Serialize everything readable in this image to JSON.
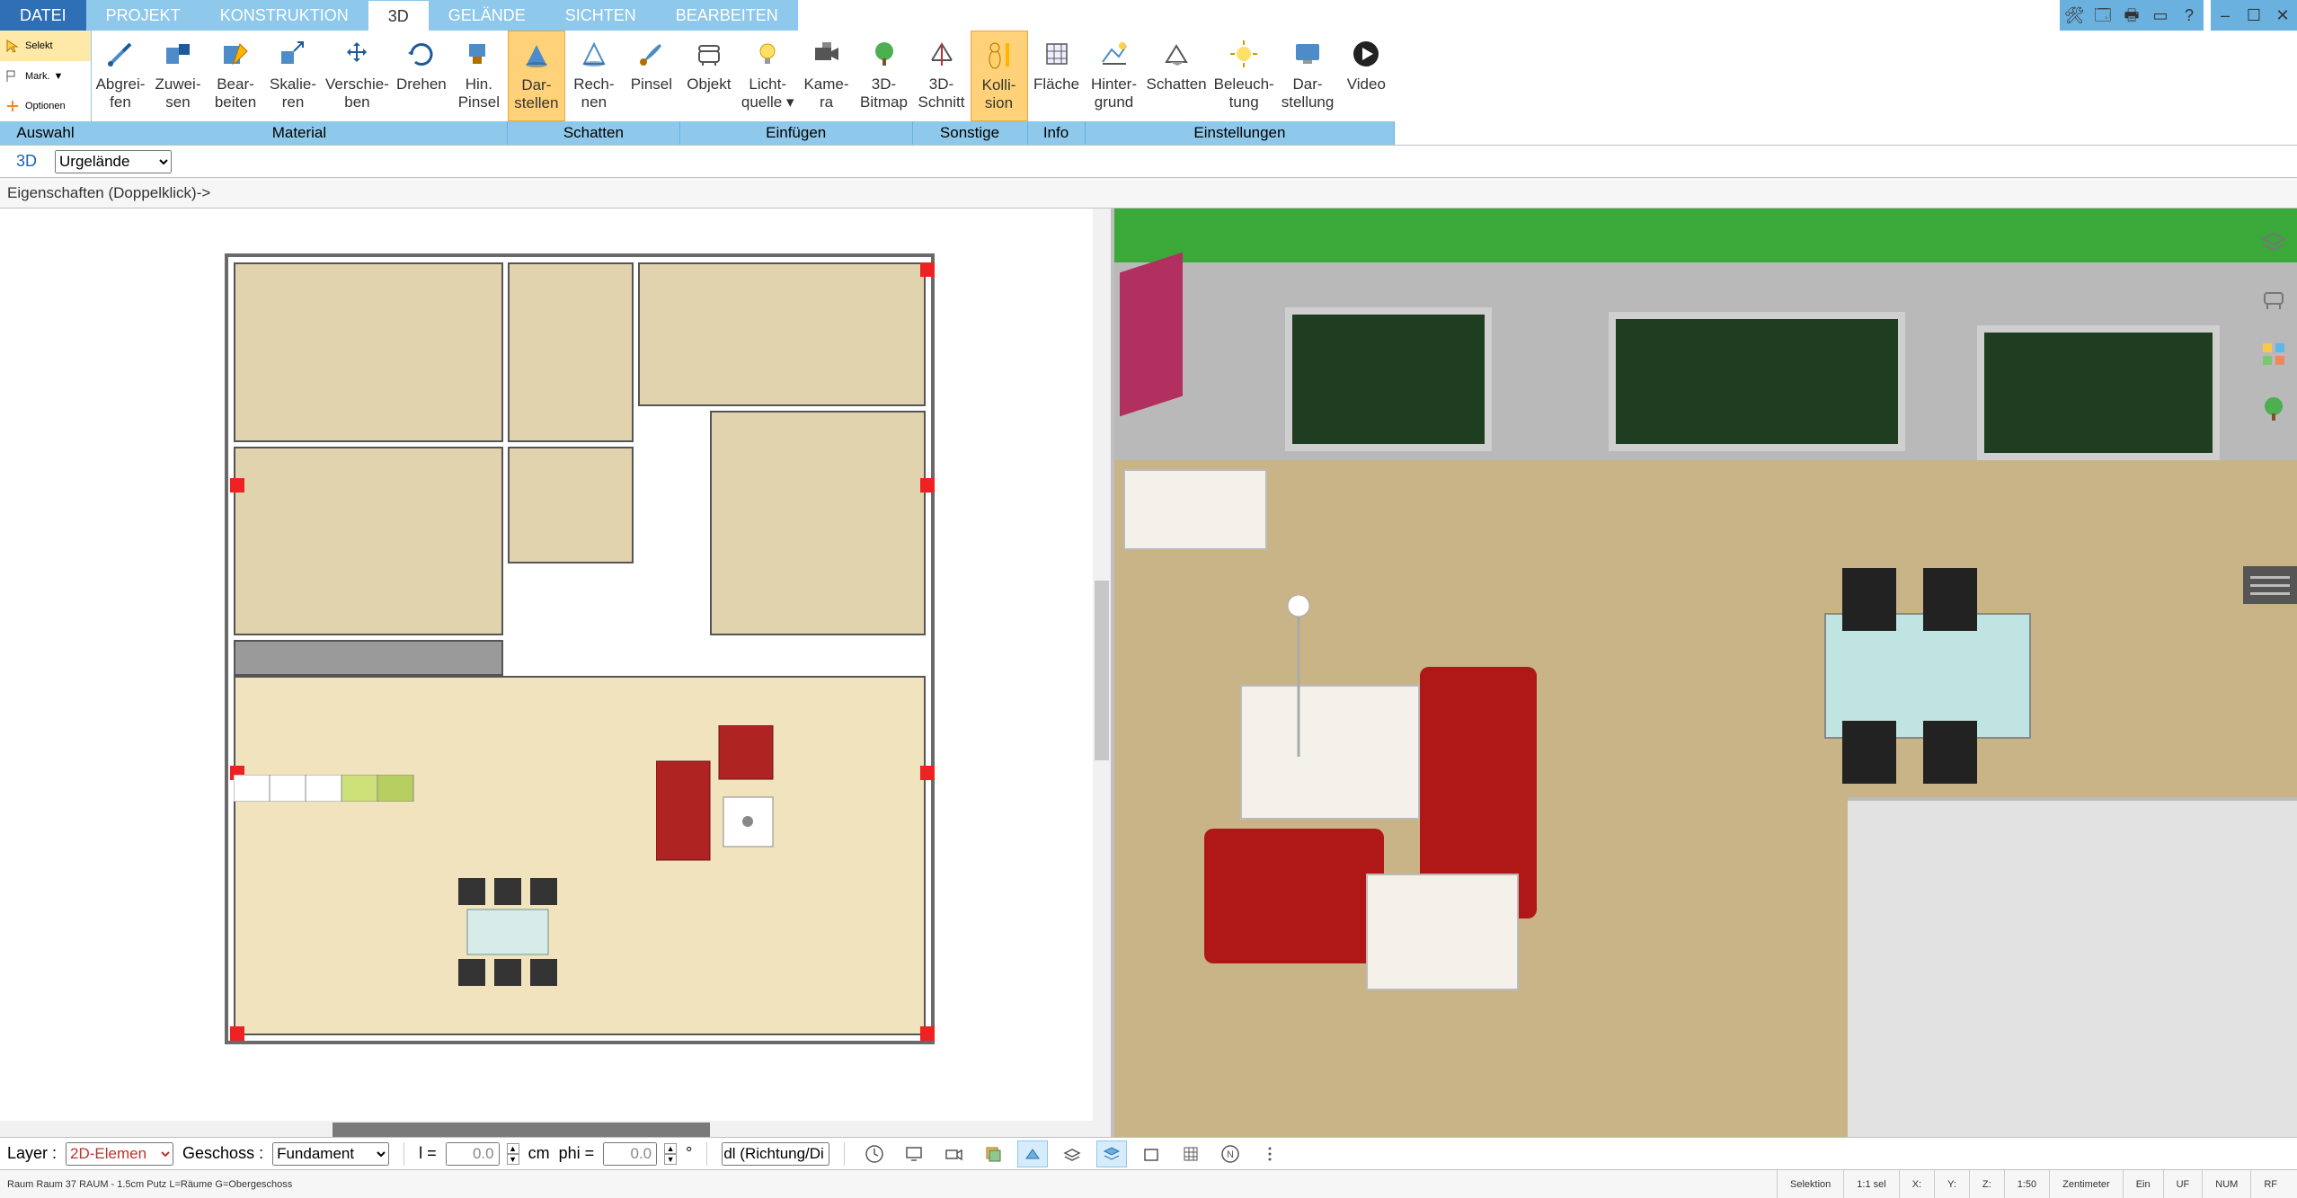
{
  "menu": {
    "tabs": [
      "DATEI",
      "PROJEKT",
      "KONSTRUKTION",
      "3D",
      "GELÄNDE",
      "SICHTEN",
      "BEARBEITEN"
    ],
    "active": 3
  },
  "winbtns": {
    "tools": "🛠",
    "save": "🗔",
    "print": "🖶",
    "window": "▭",
    "help": "?",
    "min": "–",
    "max": "☐",
    "close": "✕"
  },
  "side": {
    "selekt": "Selekt",
    "mark": "Mark.",
    "optionen": "Optionen",
    "group": "Auswahl"
  },
  "ribbon": {
    "groups": [
      {
        "label": "Material",
        "buttons": [
          {
            "id": "abgreifen",
            "l1": "Abgrei-",
            "l2": "fen"
          },
          {
            "id": "zuweisen",
            "l1": "Zuwei-",
            "l2": "sen"
          },
          {
            "id": "bearbeiten",
            "l1": "Bear-",
            "l2": "beiten"
          },
          {
            "id": "skalieren",
            "l1": "Skalie-",
            "l2": "ren"
          },
          {
            "id": "verschieben",
            "l1": "Verschie-",
            "l2": "ben"
          },
          {
            "id": "drehen",
            "l1": "Drehen",
            "l2": ""
          },
          {
            "id": "hinpinsel",
            "l1": "Hin.",
            "l2": "Pinsel"
          }
        ]
      },
      {
        "label": "Schatten",
        "buttons": [
          {
            "id": "darstellen",
            "l1": "Dar-",
            "l2": "stellen",
            "active": true
          },
          {
            "id": "rechnen",
            "l1": "Rech-",
            "l2": "nen"
          },
          {
            "id": "pinsel",
            "l1": "Pinsel",
            "l2": ""
          }
        ]
      },
      {
        "label": "Einfügen",
        "buttons": [
          {
            "id": "objekt",
            "l1": "Objekt",
            "l2": ""
          },
          {
            "id": "lichtquelle",
            "l1": "Licht-",
            "l2": "quelle ▾"
          },
          {
            "id": "kamera",
            "l1": "Kame-",
            "l2": "ra"
          },
          {
            "id": "3dbitmap",
            "l1": "3D-",
            "l2": "Bitmap"
          }
        ]
      },
      {
        "label": "Sonstige",
        "buttons": [
          {
            "id": "3dschnitt",
            "l1": "3D-",
            "l2": "Schnitt"
          },
          {
            "id": "kollision",
            "l1": "Kolli-",
            "l2": "sion",
            "active": true
          }
        ]
      },
      {
        "label": "Info",
        "buttons": [
          {
            "id": "flaeche",
            "l1": "Fläche",
            "l2": ""
          }
        ]
      },
      {
        "label": "Einstellungen",
        "buttons": [
          {
            "id": "hintergrund",
            "l1": "Hinter-",
            "l2": "grund"
          },
          {
            "id": "schatten",
            "l1": "Schatten",
            "l2": ""
          },
          {
            "id": "beleuchtung",
            "l1": "Beleuch-",
            "l2": "tung"
          },
          {
            "id": "darstellung",
            "l1": "Dar-",
            "l2": "stellung"
          },
          {
            "id": "video",
            "l1": "Video",
            "l2": ""
          }
        ]
      }
    ]
  },
  "subbar": {
    "mode": "3D",
    "combo": "Urgelände"
  },
  "propstrip": {
    "label": "Eigenschaften (Doppelklick)->"
  },
  "bottom": {
    "layer_lbl": "Layer :",
    "layer_val": "2D-Elemen",
    "geschoss_lbl": "Geschoss :",
    "geschoss_val": "Fundament",
    "l_lbl": "l =",
    "l_val": "0.0",
    "l_unit": "cm",
    "phi_lbl": "phi =",
    "phi_val": "0.0",
    "phi_unit": "°",
    "dl_val": "dl (Richtung/Di",
    "iconbtns": [
      "clock",
      "screen",
      "camera",
      "stack1",
      "tilt",
      "layers",
      "layers2",
      "box",
      "grid",
      "north",
      "more"
    ]
  },
  "status": {
    "info": "Raum Raum 37 RAUM - 1.5cm Putz L=Räume G=Obergeschoss",
    "mode": "Selektion",
    "sel": "1:1 sel",
    "x": "X:",
    "y": "Y:",
    "z": "Z:",
    "scale": "1:50",
    "unit": "Zentimeter",
    "ein": "Ein",
    "uf": "UF",
    "num": "NUM",
    "rf": "RF"
  },
  "rtools": [
    "layers",
    "furniture",
    "palette",
    "tree"
  ]
}
